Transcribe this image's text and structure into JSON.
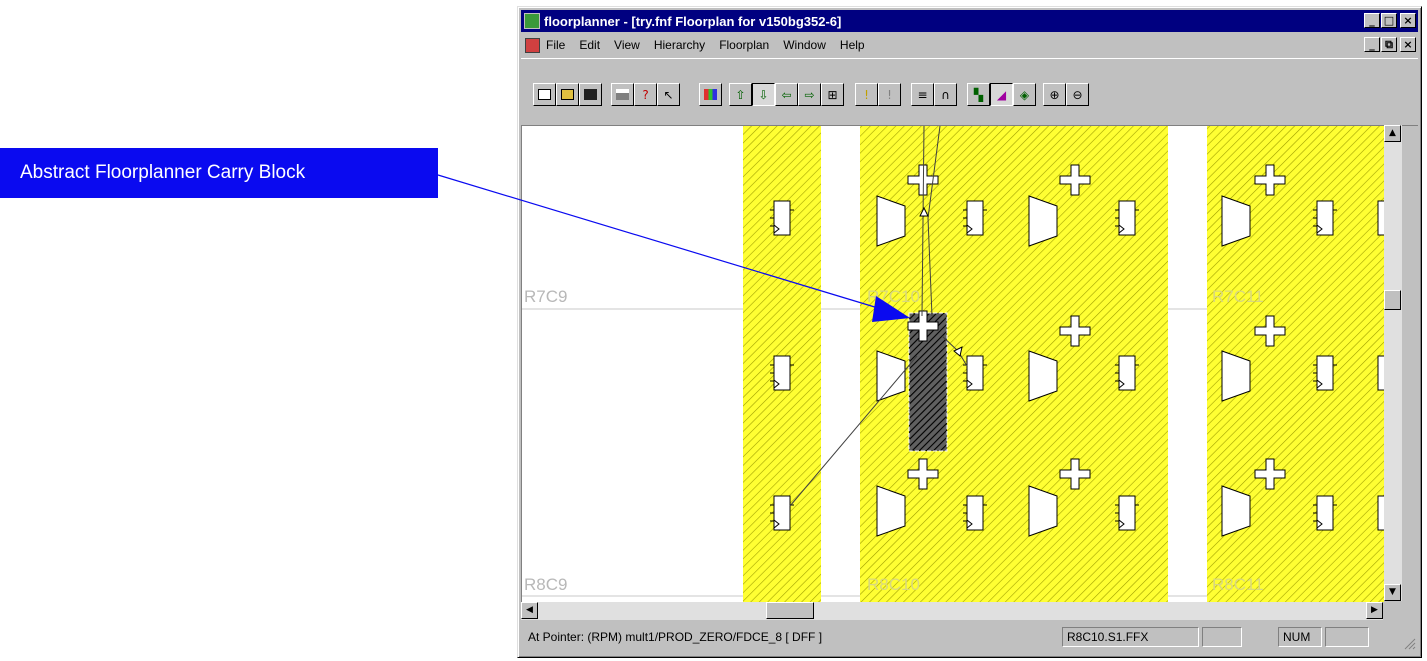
{
  "callout": {
    "text": "Abstract Floorplanner Carry Block"
  },
  "window": {
    "title": "floorplanner - [try.fnf Floorplan for v150bg352-6]",
    "title_buttons": [
      "_",
      "□",
      "×"
    ],
    "mdi_buttons": [
      "_",
      "⧉",
      "×"
    ]
  },
  "menu": [
    "File",
    "Edit",
    "View",
    "Hierarchy",
    "Floorplan",
    "Window",
    "Help"
  ],
  "toolbar": {
    "buttons": [
      {
        "icon": "new-file-icon"
      },
      {
        "icon": "open-folder-icon"
      },
      {
        "icon": "save-icon"
      },
      {
        "icon": "print-icon"
      },
      {
        "icon": "help-icon"
      },
      {
        "icon": "context-help-icon"
      },
      {
        "icon": "color-palette-icon"
      },
      {
        "icon": "push-up-icon"
      },
      {
        "icon": "push-down-icon"
      },
      {
        "icon": "arrow-left-icon"
      },
      {
        "icon": "arrow-right-icon"
      },
      {
        "icon": "hierarchy-icon"
      },
      {
        "icon": "flag-icon"
      },
      {
        "icon": "flag-gray-icon"
      },
      {
        "icon": "route-icon"
      },
      {
        "icon": "tree-icon"
      },
      {
        "icon": "rpm-icon"
      },
      {
        "icon": "pen-icon"
      },
      {
        "icon": "place-icon"
      },
      {
        "icon": "zoom-in-icon"
      },
      {
        "icon": "zoom-out-icon"
      }
    ]
  },
  "canvas": {
    "row_labels": [
      "R7C9",
      "R8C9"
    ],
    "cell_labels": [
      "R7C10",
      "R7C11",
      "R8C10",
      "R8C11"
    ]
  },
  "status": {
    "pointer": "At Pointer: (RPM)  mult1/PROD_ZERO/FDCE_8 [ DFF ]",
    "site": "R8C10.S1.FFX",
    "empty": "",
    "num": "NUM",
    "empty2": ""
  }
}
